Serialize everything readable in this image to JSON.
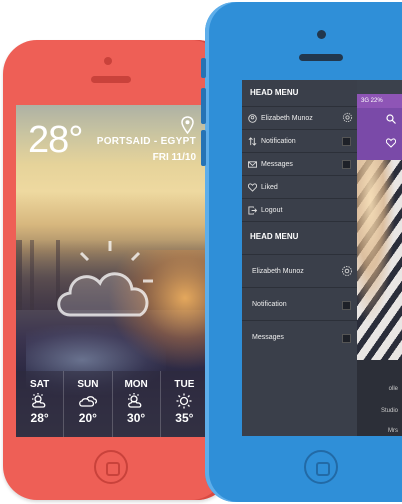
{
  "weather": {
    "temperature": "28°",
    "location": "PORTSAID - EGYPT",
    "date": "FRI  11/10",
    "forecast": [
      {
        "day": "SAT",
        "icon": "sun-cloud-icon",
        "temp": "28°"
      },
      {
        "day": "SUN",
        "icon": "cloud-icon",
        "temp": "20°"
      },
      {
        "day": "MON",
        "icon": "sun-cloud-icon",
        "temp": "30°"
      },
      {
        "day": "TUE",
        "icon": "sun-icon",
        "temp": "35°"
      }
    ]
  },
  "menu": {
    "section1_title": "HEAD MENU",
    "section1_items": [
      {
        "label": "Elizabeth Munoz",
        "icon": "user-icon"
      },
      {
        "label": "Notification",
        "icon": "swap-icon"
      },
      {
        "label": "Messages",
        "icon": "mail-icon"
      },
      {
        "label": "Liked",
        "icon": "heart-icon"
      },
      {
        "label": "Logout",
        "icon": "logout-icon"
      }
    ],
    "section2_title": "HEAD MENU",
    "section2_items": [
      {
        "label": "Elizabeth Munoz"
      },
      {
        "label": "Notification"
      },
      {
        "label": "Messages"
      }
    ]
  },
  "side_panel": {
    "status": "3G 22%",
    "bottom_labels": [
      "olle",
      "Studio",
      "Mrs"
    ]
  },
  "colors": {
    "red_phone": "#ee5f56",
    "blue_phone": "#2f8fd8",
    "menu_bg": "#3a3f4a",
    "accent_purple": "#8e55b6"
  }
}
